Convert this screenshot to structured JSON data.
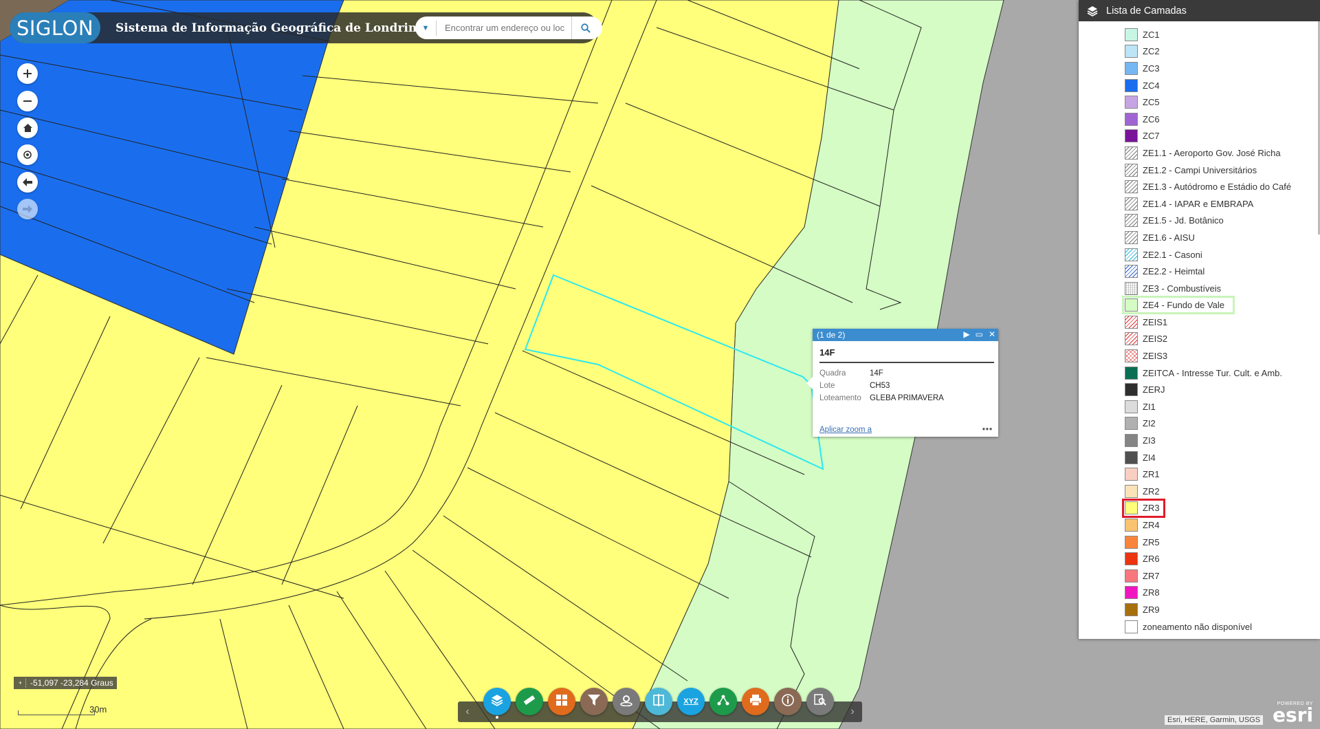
{
  "header": {
    "logo_text": "SIGLON",
    "title": "Sistema de Informação Geográfica de Londrina",
    "search_placeholder": "Encontrar um endereço ou loc"
  },
  "map_controls": [
    "zoom-in",
    "zoom-out",
    "home",
    "locate",
    "back",
    "forward"
  ],
  "coordinates": "-51,097 -23,284 Graus",
  "scale_label": "30m",
  "attribution": "Esri, HERE, Garmin, USGS",
  "esri_logo": {
    "powered": "POWERED BY",
    "brand": "esri"
  },
  "popup": {
    "header": "(1 de 2)",
    "title": "14F",
    "fields": [
      {
        "label": "Quadra",
        "value": "14F"
      },
      {
        "label": "Lote",
        "value": "CH53"
      },
      {
        "label": "Loteamento",
        "value": "GLEBA PRIMAVERA"
      }
    ],
    "zoom_link": "Aplicar zoom a",
    "more": "•••"
  },
  "layer_list": {
    "title": "Lista de Camadas",
    "items": [
      {
        "label": "ZC1",
        "color": "#c7f7e4",
        "pattern": "solid"
      },
      {
        "label": "ZC2",
        "color": "#bde4f7",
        "pattern": "solid"
      },
      {
        "label": "ZC3",
        "color": "#75b7f2",
        "pattern": "solid"
      },
      {
        "label": "ZC4",
        "color": "#1a6eee",
        "pattern": "solid"
      },
      {
        "label": "ZC5",
        "color": "#c6a4e4",
        "pattern": "solid"
      },
      {
        "label": "ZC6",
        "color": "#a065d2",
        "pattern": "solid"
      },
      {
        "label": "ZC7",
        "color": "#7b139a",
        "pattern": "solid"
      },
      {
        "label": "ZE1.1 - Aeroporto Gov. José Richa",
        "color": "#777777",
        "pattern": "hatch"
      },
      {
        "label": "ZE1.2 - Campi Universitários",
        "color": "#777777",
        "pattern": "hatch"
      },
      {
        "label": "ZE1.3 - Autódromo e Estádio do Café",
        "color": "#777777",
        "pattern": "hatch"
      },
      {
        "label": "ZE1.4 - IAPAR e EMBRAPA",
        "color": "#777777",
        "pattern": "hatch"
      },
      {
        "label": "ZE1.5 - Jd. Botânico",
        "color": "#777777",
        "pattern": "hatch"
      },
      {
        "label": "ZE1.6 - AISU",
        "color": "#777777",
        "pattern": "hatch"
      },
      {
        "label": "ZE2.1 - Casoni",
        "color": "#2ab7d8",
        "pattern": "hatch"
      },
      {
        "label": "ZE2.2 - Heimtal",
        "color": "#2a5fc8",
        "pattern": "hatch"
      },
      {
        "label": "ZE3 - Combustíveis",
        "color": "#aaaaaa",
        "pattern": "dots"
      },
      {
        "label": "ZE4 - Fundo de Vale",
        "color": "#d4fcc4",
        "pattern": "solid"
      },
      {
        "label": "ZEIS1",
        "color": "#e03030",
        "pattern": "hatch"
      },
      {
        "label": "ZEIS2",
        "color": "#e03030",
        "pattern": "hatch"
      },
      {
        "label": "ZEIS3",
        "color": "#e88888",
        "pattern": "cross"
      },
      {
        "label": "ZEITCA - Intresse Tur. Cult. e Amb.",
        "color": "#0a6e55",
        "pattern": "solid"
      },
      {
        "label": "ZERJ",
        "color": "#2e2e2e",
        "pattern": "solid"
      },
      {
        "label": "ZI1",
        "color": "#dcdcdc",
        "pattern": "solid"
      },
      {
        "label": "ZI2",
        "color": "#b0b0b0",
        "pattern": "solid"
      },
      {
        "label": "ZI3",
        "color": "#858585",
        "pattern": "solid"
      },
      {
        "label": "ZI4",
        "color": "#505050",
        "pattern": "solid"
      },
      {
        "label": "ZR1",
        "color": "#f9cfc2",
        "pattern": "solid"
      },
      {
        "label": "ZR2",
        "color": "#fae2b9",
        "pattern": "solid"
      },
      {
        "label": "ZR3",
        "color": "#ffff7b",
        "pattern": "solid"
      },
      {
        "label": "ZR4",
        "color": "#f9c371",
        "pattern": "solid"
      },
      {
        "label": "ZR5",
        "color": "#f9853c",
        "pattern": "solid"
      },
      {
        "label": "ZR6",
        "color": "#ec3410",
        "pattern": "solid"
      },
      {
        "label": "ZR7",
        "color": "#f7777d",
        "pattern": "solid"
      },
      {
        "label": "ZR8",
        "color": "#f015c0",
        "pattern": "solid"
      },
      {
        "label": "ZR9",
        "color": "#a8700d",
        "pattern": "solid"
      },
      {
        "label": "zoneamento não disponível",
        "color": "#ffffff",
        "pattern": "solid"
      }
    ],
    "highlight_green": "ZE4 - Fundo de Vale",
    "highlight_red": "ZR3"
  },
  "toolbar": {
    "tools": [
      {
        "name": "layers-tool",
        "color": "#1aa3e0"
      },
      {
        "name": "measure-tool",
        "color": "#1e9a4b"
      },
      {
        "name": "basemap-tool",
        "color": "#e06b1d"
      },
      {
        "name": "filter-tool",
        "color": "#8a6a55"
      },
      {
        "name": "location-tool",
        "color": "#7a7a7a"
      },
      {
        "name": "swipe-tool",
        "color": "#4db8d8"
      },
      {
        "name": "coordinate-tool",
        "color": "#1aa3e0"
      },
      {
        "name": "share-tool",
        "color": "#1e9a4b"
      },
      {
        "name": "print-tool",
        "color": "#e06b1d"
      },
      {
        "name": "info-tool",
        "color": "#8a6a55"
      },
      {
        "name": "query-tool",
        "color": "#7a7a7a"
      }
    ],
    "xyz_label": "XYZ"
  },
  "colors": {
    "zr3": "#ffff7b",
    "ze4": "#d4fcc4",
    "zc4": "#1a6eee",
    "road": "#ffff7b",
    "outside": "#a9a9a9",
    "selection": "#2de8f0",
    "header_accent": "#2a7fb8"
  }
}
